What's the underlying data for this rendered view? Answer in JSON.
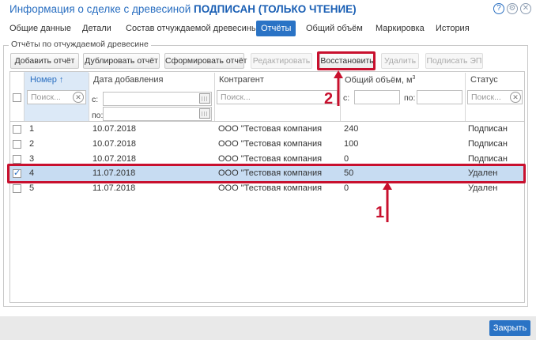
{
  "window": {
    "title_prefix": "Информация о сделке с древесиной ",
    "title_status": "ПОДПИСАН (ТОЛЬКО ЧТЕНИЕ)",
    "icons": [
      "help-icon",
      "settings-icon",
      "close-icon"
    ]
  },
  "tabs": [
    {
      "label": "Общие данные"
    },
    {
      "label": "Детали"
    },
    {
      "label": "Состав отчуждаемой древесины"
    },
    {
      "label": "Отчёты",
      "active": true
    },
    {
      "label": "Общий объём"
    },
    {
      "label": "Маркировка"
    },
    {
      "label": "История"
    }
  ],
  "group": {
    "legend": "Отчёты по отчуждаемой древесине"
  },
  "toolbar": {
    "add": "Добавить отчёт",
    "duplicate": "Дублировать отчёт",
    "generate": "Сформировать отчёт",
    "edit": "Редактировать",
    "restore": "Восстановить",
    "delete": "Удалить",
    "sign": "Подписать ЭП"
  },
  "columns": {
    "number": "Номер",
    "date": "Дата добавления",
    "counterparty": "Контрагент",
    "volume": "Общий объём, м",
    "volume_sup": "3",
    "status": "Статус"
  },
  "filters": {
    "search_placeholder": "Поиск...",
    "from_label": "с:",
    "to_label": "по:",
    "clear": "⊗"
  },
  "rows": [
    {
      "number": "1",
      "date": "10.07.2018",
      "counterparty": "ООО \"Тестовая компания",
      "volume": "240",
      "status": "Подписан",
      "checked": false
    },
    {
      "number": "2",
      "date": "10.07.2018",
      "counterparty": "ООО \"Тестовая компания",
      "volume": "100",
      "status": "Подписан",
      "checked": false
    },
    {
      "number": "3",
      "date": "10.07.2018",
      "counterparty": "ООО \"Тестовая компания",
      "volume": "0",
      "status": "Подписан",
      "checked": false
    },
    {
      "number": "4",
      "date": "11.07.2018",
      "counterparty": "ООО \"Тестовая компания",
      "volume": "50",
      "status": "Удален",
      "checked": true
    },
    {
      "number": "5",
      "date": "11.07.2018",
      "counterparty": "ООО \"Тестовая компания",
      "volume": "0",
      "status": "Удален",
      "checked": false
    }
  ],
  "footer": {
    "close": "Закрыть"
  },
  "annotations": {
    "step1": "1",
    "step2": "2",
    "color": "#c8102e"
  },
  "colors": {
    "accent": "#2a73c5",
    "selected_row": "#c7dcf2"
  }
}
